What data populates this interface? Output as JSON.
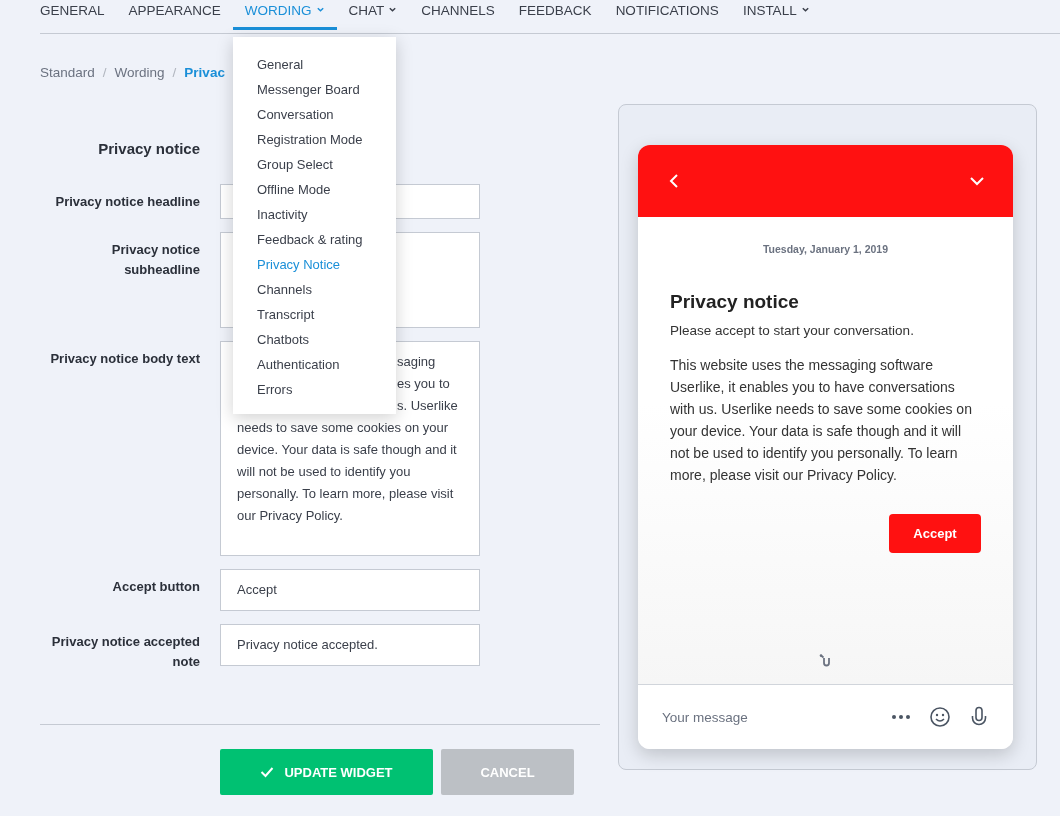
{
  "nav": [
    {
      "label": "GENERAL",
      "selected": false,
      "dropdown": false
    },
    {
      "label": "APPEARANCE",
      "selected": false,
      "dropdown": false
    },
    {
      "label": "WORDING",
      "selected": true,
      "dropdown": true
    },
    {
      "label": "CHAT",
      "selected": false,
      "dropdown": true
    },
    {
      "label": "CHANNELS",
      "selected": false,
      "dropdown": false
    },
    {
      "label": "FEEDBACK",
      "selected": false,
      "dropdown": false
    },
    {
      "label": "NOTIFICATIONS",
      "selected": false,
      "dropdown": false
    },
    {
      "label": "INSTALL",
      "selected": false,
      "dropdown": true
    }
  ],
  "breadcrumb": [
    {
      "label": "Standard",
      "current": false
    },
    {
      "separator": "/",
      "label": "Wording",
      "current": false
    },
    {
      "separator": "/",
      "label": "Privac",
      "current": true
    }
  ],
  "menu": [
    {
      "label": "General",
      "selected": false
    },
    {
      "label": "Messenger Board",
      "selected": false
    },
    {
      "label": "Conversation",
      "selected": false
    },
    {
      "label": "Registration Mode",
      "selected": false
    },
    {
      "label": "Group Select",
      "selected": false
    },
    {
      "label": "Offline Mode",
      "selected": false
    },
    {
      "label": "Inactivity",
      "selected": false
    },
    {
      "label": "Feedback & rating",
      "selected": false
    },
    {
      "label": "Privacy Notice",
      "selected": true
    },
    {
      "label": "Channels",
      "selected": false
    },
    {
      "label": "Transcript",
      "selected": false
    },
    {
      "label": "Chatbots",
      "selected": false
    },
    {
      "label": "Authentication",
      "selected": false
    },
    {
      "label": "Errors",
      "selected": false
    }
  ],
  "form": {
    "title": "Privacy notice",
    "fields": [
      {
        "label": "Privacy notice headline",
        "kind": "input"
      },
      {
        "label": "Privacy notice subheadline",
        "kind": "textarea"
      },
      {
        "label": "Privacy notice body text",
        "kind": "textarea",
        "partial_lines": [
          "saging",
          "es you to",
          "s. Userlike"
        ],
        "value": "needs to save some cookies on your device. Your data is safe though and it will not be used to identify you personally. To learn more, please visit our Privacy Policy."
      },
      {
        "label": "Accept button",
        "kind": "input",
        "value": "Accept"
      },
      {
        "label": "Privacy notice accepted note",
        "kind": "input",
        "value": "Privacy notice accepted."
      }
    ]
  },
  "buttons": [
    {
      "label": "UPDATE WIDGET",
      "kind": "primary"
    },
    {
      "label": "CANCEL",
      "kind": "secondary"
    }
  ],
  "preview": {
    "date": "Tuesday, January 1, 2019",
    "title": "Privacy notice",
    "subtitle": "Please accept to start your conversation.",
    "body": "This website uses the messaging software Userlike, it enables you to have conversations with us. Userlike needs to save some cookies on your device. Your data is safe though and it will not be used to identify you personally. To learn more, please visit our Privacy Policy.",
    "accept": "Accept",
    "message_placeholder": "Your message"
  }
}
